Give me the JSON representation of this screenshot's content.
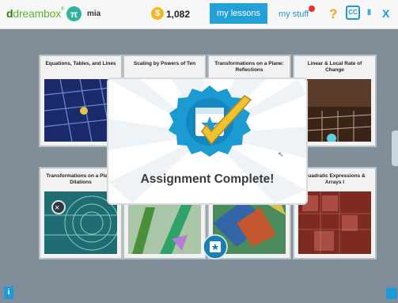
{
  "header": {
    "logo_text": "dreambox",
    "avatar_glyph": "π",
    "username": "mia",
    "coin_symbol": "$",
    "coins": "1,082",
    "tab_lessons": "my lessons",
    "tab_stuff": "my stuff",
    "help": "?",
    "cc": "CC",
    "pause": "II",
    "close": "X"
  },
  "lessons": [
    {
      "title": "Equations, Tables, and Lines"
    },
    {
      "title": "Scaling by Powers of Ten"
    },
    {
      "title": "Transformations on a Plane: Reflections"
    },
    {
      "title": "Linear & Local Rate of Change"
    },
    {
      "title": "Transformations on a Plane: Dilations"
    },
    {
      "title": ""
    },
    {
      "title": ""
    },
    {
      "title": "Quadratic Expressions & Arrays I"
    }
  ],
  "modal": {
    "text": "Assignment Complete!"
  },
  "footer": {
    "info": "i"
  },
  "colors": {
    "accent": "#23a0d7",
    "brand_green": "#63b22f",
    "coin": "#f2b722",
    "alert": "#e8302b"
  }
}
